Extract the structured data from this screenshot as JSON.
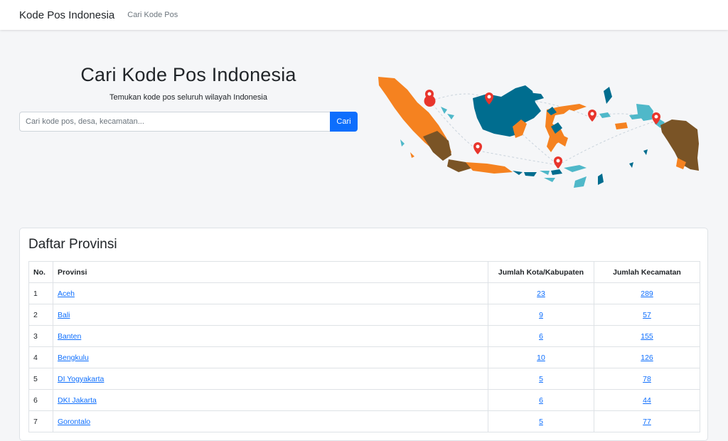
{
  "nav": {
    "brand": "Kode Pos Indonesia",
    "link": "Cari Kode Pos"
  },
  "hero": {
    "title": "Cari Kode Pos Indonesia",
    "subtitle": "Temukan kode pos seluruh wilayah Indonesia",
    "search_placeholder": "Cari kode pos, desa, kecamatan...",
    "search_button": "Cari"
  },
  "colors": {
    "orange": "#f58220",
    "teal": "#006d8f",
    "brown": "#7a5426",
    "cyan": "#4fb8c9",
    "pin": "#e8352c"
  },
  "provinces": {
    "title": "Daftar Provinsi",
    "headers": [
      "No.",
      "Provinsi",
      "Jumlah Kota/Kabupaten",
      "Jumlah Kecamatan"
    ],
    "rows": [
      {
        "no": "1",
        "name": "Aceh",
        "kota": "23",
        "kec": "289"
      },
      {
        "no": "2",
        "name": "Bali",
        "kota": "9",
        "kec": "57"
      },
      {
        "no": "3",
        "name": "Banten",
        "kota": "6",
        "kec": "155"
      },
      {
        "no": "4",
        "name": "Bengkulu",
        "kota": "10",
        "kec": "126"
      },
      {
        "no": "5",
        "name": "DI Yogyakarta",
        "kota": "5",
        "kec": "78"
      },
      {
        "no": "6",
        "name": "DKI Jakarta",
        "kota": "6",
        "kec": "44"
      },
      {
        "no": "7",
        "name": "Gorontalo",
        "kota": "5",
        "kec": "77"
      }
    ]
  }
}
